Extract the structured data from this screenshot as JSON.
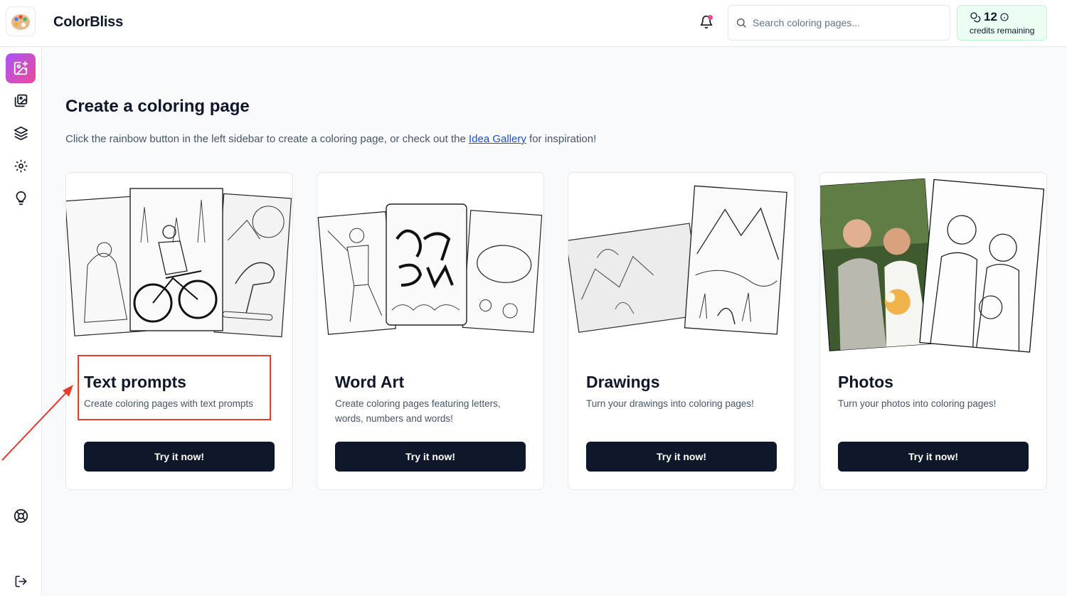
{
  "app": {
    "brand": "ColorBliss"
  },
  "header": {
    "search_placeholder": "Search coloring pages...",
    "credits_count": "12",
    "credits_label": "credits remaining"
  },
  "sidebar": {
    "items": [
      {
        "icon": "create-image-icon",
        "active": true
      },
      {
        "icon": "gallery-icon",
        "active": false
      },
      {
        "icon": "layers-icon",
        "active": false
      },
      {
        "icon": "settings-icon",
        "active": false
      },
      {
        "icon": "lightbulb-icon",
        "active": false
      },
      {
        "icon": "help-icon",
        "active": false
      },
      {
        "icon": "logout-icon",
        "active": false
      }
    ]
  },
  "main": {
    "title": "Create a coloring page",
    "subtitle_before": "Click the rainbow button in the left sidebar to create a coloring page, or check out the ",
    "subtitle_link": "Idea Gallery",
    "subtitle_after": " for inspiration!",
    "cards": [
      {
        "title": "Text prompts",
        "description": "Create coloring pages with text prompts",
        "button": "Try it now!"
      },
      {
        "title": "Word Art",
        "description": "Create coloring pages featuring letters, words, numbers and words!",
        "button": "Try it now!"
      },
      {
        "title": "Drawings",
        "description": "Turn your drawings into coloring pages!",
        "button": "Try it now!"
      },
      {
        "title": "Photos",
        "description": "Turn your photos into coloring pages!",
        "button": "Try it now!"
      }
    ]
  },
  "colors": {
    "accent_gradient_start": "#a855f7",
    "accent_gradient_end": "#ec4899",
    "button_bg": "#0f172a",
    "annotation_red": "#e53e2c",
    "credits_bg": "#ecfdf3"
  }
}
